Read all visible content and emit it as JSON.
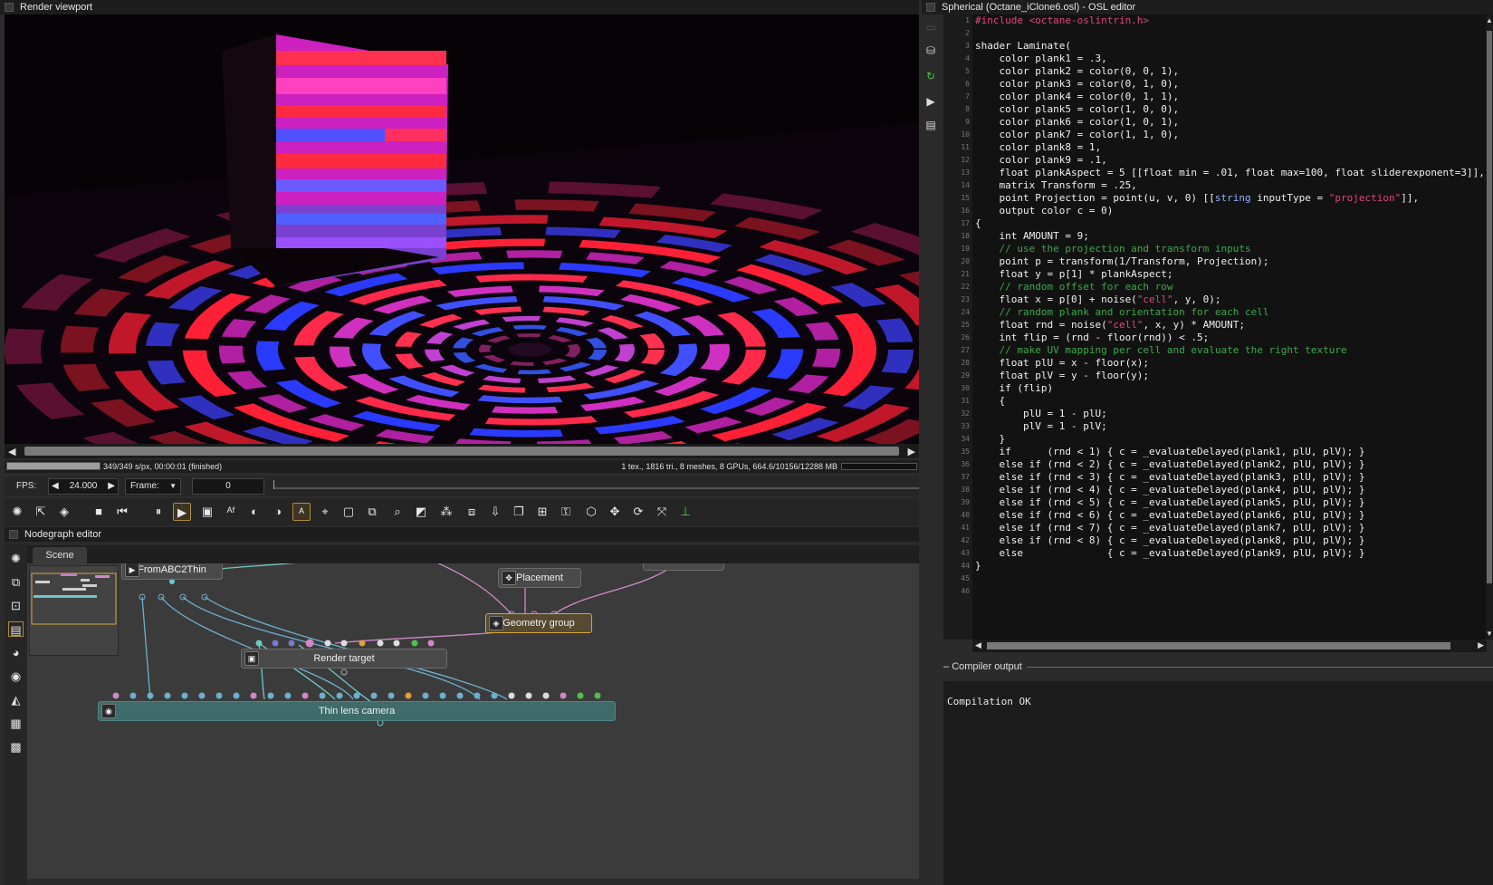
{
  "viewport": {
    "title": "Render viewport",
    "status_left": "349/349 s/px, 00:00:01 (finished)",
    "status_right": "1 tex., 1816 tri., 8 meshes, 8 GPUs, 664.6/10156/12288 MB",
    "progress": 1.0
  },
  "playback": {
    "fps_label": "FPS:",
    "fps_value": "24.000",
    "frame_label": "Frame:",
    "frame_value": "0"
  },
  "nodegraph": {
    "title": "Nodegraph editor",
    "tab": "Scene",
    "nodes": {
      "placement": "Placement",
      "fromabc": "FromABC2Thin",
      "geometry_group": "Geometry group",
      "render_target": "Render target",
      "camera": "Thin lens camera"
    }
  },
  "osl": {
    "title": "Spherical (Octane_iClone6.osl) - OSL editor",
    "line_numbers": [
      "1",
      "2",
      "3",
      "4",
      "5",
      "6",
      "7",
      "8",
      "9",
      "10",
      "11",
      "12",
      "13",
      "14",
      "15",
      "16",
      "17",
      "18",
      "19",
      "20",
      "21",
      "22",
      "23",
      "24",
      "25",
      "26",
      "27",
      "28",
      "29",
      "30",
      "31",
      "32",
      "33",
      "34",
      "35",
      "36",
      "37",
      "38",
      "39",
      "40",
      "41",
      "42",
      "43",
      "44",
      "45",
      "46"
    ],
    "lines": [
      "#include <octane-oslintrin.h>",
      "",
      "shader Laminate(",
      "    color plank1 = .3,",
      "    color plank2 = color(0, 0, 1),",
      "    color plank3 = color(0, 1, 0),",
      "    color plank4 = color(0, 1, 1),",
      "    color plank5 = color(1, 0, 0),",
      "    color plank6 = color(1, 0, 1),",
      "    color plank7 = color(1, 1, 0),",
      "    color plank8 = 1,",
      "    color plank9 = .1,",
      "    float plankAspect = 5 [[float min = .01, float max=100, float sliderexponent=3]],",
      "    matrix Transform = .25,",
      "    point Projection = point(u, v, 0) [[string inputType = \"projection\"]],",
      "    output color c = 0)",
      "{",
      "    int AMOUNT = 9;",
      "    // use the projection and transform inputs",
      "    point p = transform(1/Transform, Projection);",
      "    float y = p[1] * plankAspect;",
      "    // random offset for each row",
      "    float x = p[0] + noise(\"cell\", y, 0);",
      "    // random plank and orientation for each cell",
      "    float rnd = noise(\"cell\", x, y) * AMOUNT;",
      "    int flip = (rnd - floor(rnd)) < .5;",
      "    // make UV mapping per cell and evaluate the right texture",
      "    float plU = x - floor(x);",
      "    float plV = y - floor(y);",
      "    if (flip)",
      "    {",
      "        plU = 1 - plU;",
      "        plV = 1 - plV;",
      "    }",
      "    if      (rnd < 1) { c = _evaluateDelayed(plank1, plU, plV); }",
      "    else if (rnd < 2) { c = _evaluateDelayed(plank2, plU, plV); }",
      "    else if (rnd < 3) { c = _evaluateDelayed(plank3, plU, plV); }",
      "    else if (rnd < 4) { c = _evaluateDelayed(plank4, plU, plV); }",
      "    else if (rnd < 5) { c = _evaluateDelayed(plank5, plU, plV); }",
      "    else if (rnd < 6) { c = _evaluateDelayed(plank6, plU, plV); }",
      "    else if (rnd < 7) { c = _evaluateDelayed(plank7, plU, plV); }",
      "    else if (rnd < 8) { c = _evaluateDelayed(plank8, plU, plV); }",
      "    else              { c = _evaluateDelayed(plank9, plU, plV); }",
      "}",
      "",
      ""
    ]
  },
  "compiler": {
    "title": "Compiler output",
    "output": "Compilation OK"
  },
  "colors": {
    "accent_select": "#d7a640",
    "comment": "#3ea84a",
    "string": "#e0487b",
    "camera_node": "#3e6c6a"
  }
}
